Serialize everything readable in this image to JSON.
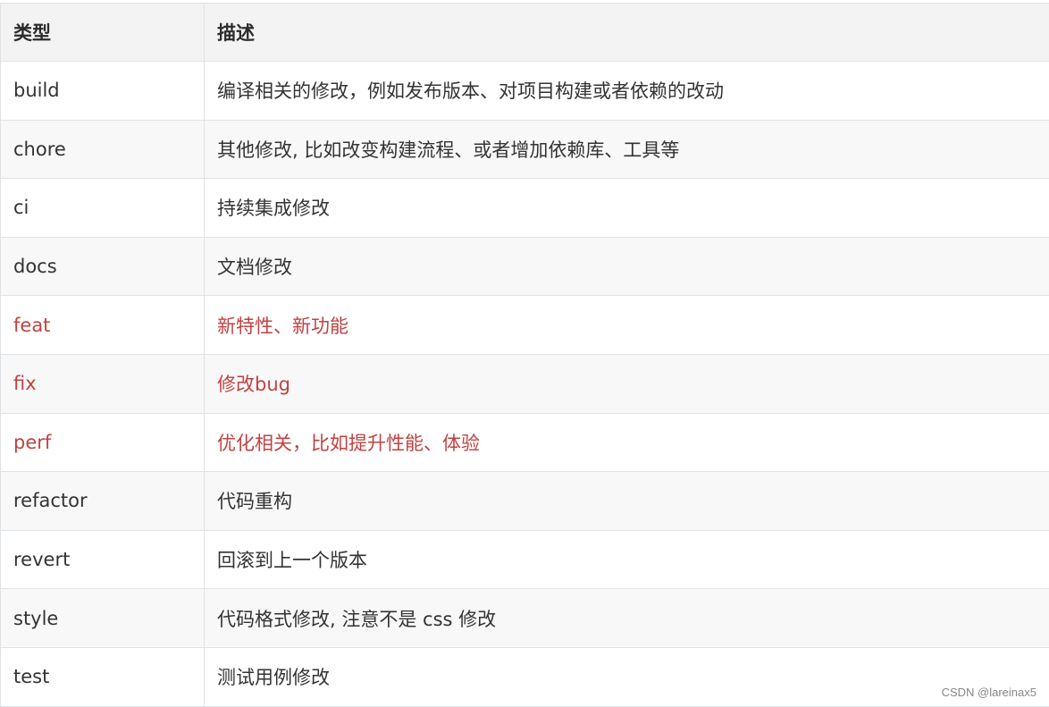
{
  "table": {
    "headers": {
      "type": "类型",
      "desc": "描述"
    },
    "rows": [
      {
        "type": "build",
        "desc": "编译相关的修改，例如发布版本、对项目构建或者依赖的改动"
      },
      {
        "type": "chore",
        "desc": "其他修改, 比如改变构建流程、或者增加依赖库、工具等"
      },
      {
        "type": "ci",
        "desc": "持续集成修改"
      },
      {
        "type": "docs",
        "desc": "文档修改"
      },
      {
        "type": "feat",
        "desc": "新特性、新功能"
      },
      {
        "type": "fix",
        "desc": "修改bug"
      },
      {
        "type": "perf",
        "desc": "优化相关，比如提升性能、体验"
      },
      {
        "type": "refactor",
        "desc": "代码重构"
      },
      {
        "type": "revert",
        "desc": "回滚到上一个版本"
      },
      {
        "type": "style",
        "desc": "代码格式修改, 注意不是 css 修改"
      },
      {
        "type": "test",
        "desc": "测试用例修改"
      }
    ]
  },
  "colors": {
    "highlight": "#c14242",
    "text": "#333333",
    "header_bg": "#f3f3f3",
    "stripe_bg": "#f8f8f8",
    "border": "#dfe2e5"
  },
  "watermark": "CSDN @lareinax5"
}
